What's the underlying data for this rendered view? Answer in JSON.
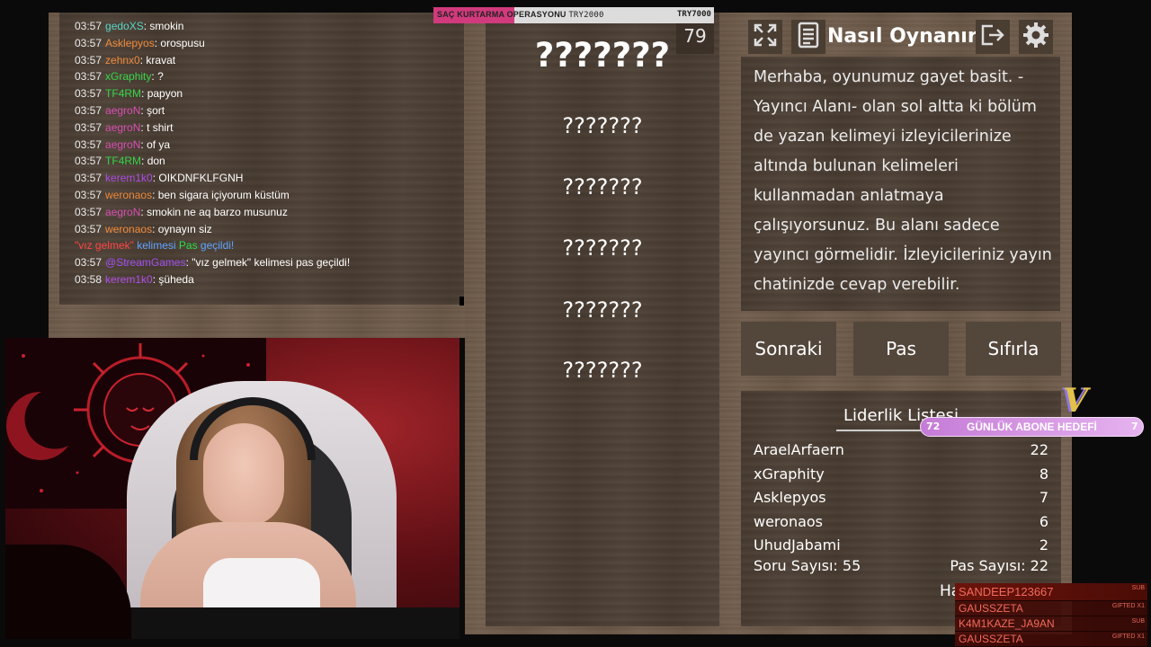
{
  "chat": {
    "messages": [
      {
        "time": "03:57",
        "user": "gedoXS",
        "color": "#58d6c8",
        "text": "smokin"
      },
      {
        "time": "03:57",
        "user": "Asklepyos",
        "color": "#f08a3c",
        "text": "orospusu"
      },
      {
        "time": "03:57",
        "user": "zehnx0",
        "color": "#f08a3c",
        "text": "kravat"
      },
      {
        "time": "03:57",
        "user": "xGraphity",
        "color": "#35d448",
        "text": "?"
      },
      {
        "time": "03:57",
        "user": "TF4RM",
        "color": "#35d448",
        "text": "papyon"
      },
      {
        "time": "03:57",
        "user": "aegroN",
        "color": "#d94fb4",
        "text": "şort"
      },
      {
        "time": "03:57",
        "user": "aegroN",
        "color": "#d94fb4",
        "text": "t shirt"
      },
      {
        "time": "03:57",
        "user": "aegroN",
        "color": "#d94fb4",
        "text": "of ya"
      },
      {
        "time": "03:57",
        "user": "TF4RM",
        "color": "#35d448",
        "text": "don"
      },
      {
        "time": "03:57",
        "user": "kerem1k0",
        "color": "#b04ee8",
        "text": "OIKDNFKLFGNH"
      },
      {
        "time": "03:57",
        "user": "weronaos",
        "color": "#f08a3c",
        "text": "ben sigara içiyorum küstüm"
      },
      {
        "time": "03:57",
        "user": "aegroN",
        "color": "#d94fb4",
        "text": "smokin ne aq barzo musunuz"
      },
      {
        "time": "03:57",
        "user": "weronaos",
        "color": "#f08a3c",
        "text": "oynayın siz"
      }
    ],
    "notice": {
      "word": "\"vız gelmek\"",
      "mid": " kelimesi ",
      "pass": "Pas",
      "end": " geçildi!"
    },
    "bot_message": {
      "time": "03:57",
      "user": "@StreamGames",
      "color": "#a24ef0",
      "text": "\"vız gelmek\" kelimesi pas geçildi!"
    },
    "last_message": {
      "time": "03:58",
      "user": "kerem1k0",
      "color": "#b04ee8",
      "text": "şüheda"
    }
  },
  "game": {
    "timer": "79",
    "main_word": "???????",
    "forbidden_words": [
      "???????",
      "???????",
      "???????",
      "???????",
      "???????"
    ],
    "title": "Nasıl Oynanır?",
    "info_text": "Merhaba, oyunumuz gayet basit. -Yayıncı Alanı- olan sol altta ki bölüm de yazan kelimeyi izleyicilerinize altında bulunan kelimeleri kullanmadan anlatmaya çalışıyorsunuz. Bu alanı sadece yayıncı görmelidir. İzleyicileriniz yayın chatinizde cevap verebilir.",
    "buttons": {
      "next": "Sonraki",
      "pass": "Pas",
      "reset": "Sıfırla"
    },
    "icons": {
      "expand": "expand-icon",
      "list": "document-icon",
      "exit": "exit-arrow-icon",
      "settings": "gear-icon"
    },
    "leaderboard": {
      "title": "Liderlik Listesi",
      "rows": [
        {
          "name": "AraelArfaern",
          "score": "22"
        },
        {
          "name": "xGraphity",
          "score": "8"
        },
        {
          "name": "Asklepyos",
          "score": "7"
        },
        {
          "name": "weronaos",
          "score": "6"
        },
        {
          "name": "UhudJabami",
          "score": "2"
        }
      ],
      "question_count": "Soru Sayısı: 55",
      "pass_count": "Pas Sayısı: 22",
      "partial_text": "Ha"
    }
  },
  "goal_bar": {
    "label": "SAÇ KURTARMA OPERASYONU",
    "current": "TRY2000",
    "target": "TRY7000",
    "progress": 0.29,
    "fill_color": "#d13a7c"
  },
  "sub_goal": {
    "left": "72",
    "label": "GÜNLÜK ABONE HEDEFİ",
    "right": "7",
    "logo": "V"
  },
  "events": [
    {
      "name": "SANDEEP123667",
      "type": "SUB"
    },
    {
      "name": "GAUSSZETA",
      "type": "GIFTED X1"
    },
    {
      "name": "K4M1KAZE_JA9AN",
      "type": "SUB"
    },
    {
      "name": "GAUSSZETA",
      "type": "GIFTED X1"
    }
  ]
}
